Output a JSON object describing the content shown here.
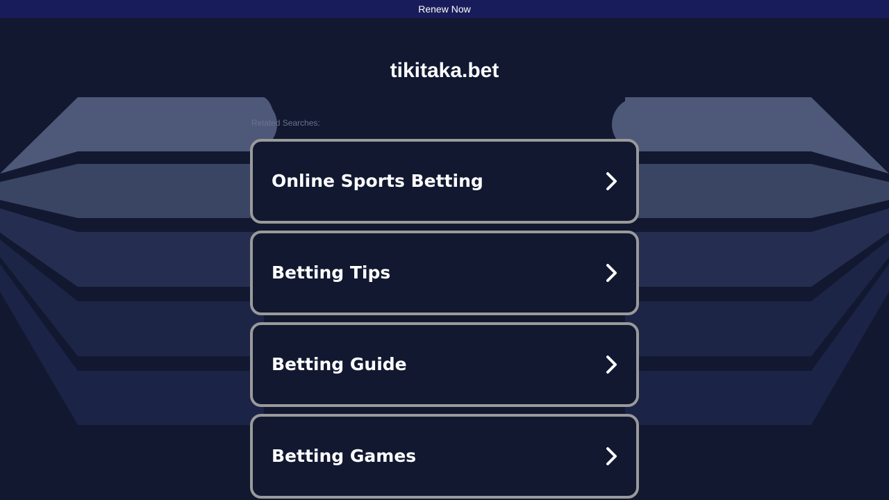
{
  "banner": {
    "label": "Renew Now"
  },
  "site": {
    "domain": "tikitaka.bet"
  },
  "related": {
    "label": "Related Searches:",
    "items": [
      {
        "label": "Online Sports Betting",
        "icon": "chevron-right-icon"
      },
      {
        "label": "Betting Tips",
        "icon": "chevron-right-icon"
      },
      {
        "label": "Betting Guide",
        "icon": "chevron-right-icon"
      },
      {
        "label": "Betting Games",
        "icon": "chevron-right-icon"
      }
    ]
  },
  "colors": {
    "background": "#111830",
    "banner": "#191c5a",
    "card_border": "#9a9a9a",
    "text": "#ffffff"
  }
}
